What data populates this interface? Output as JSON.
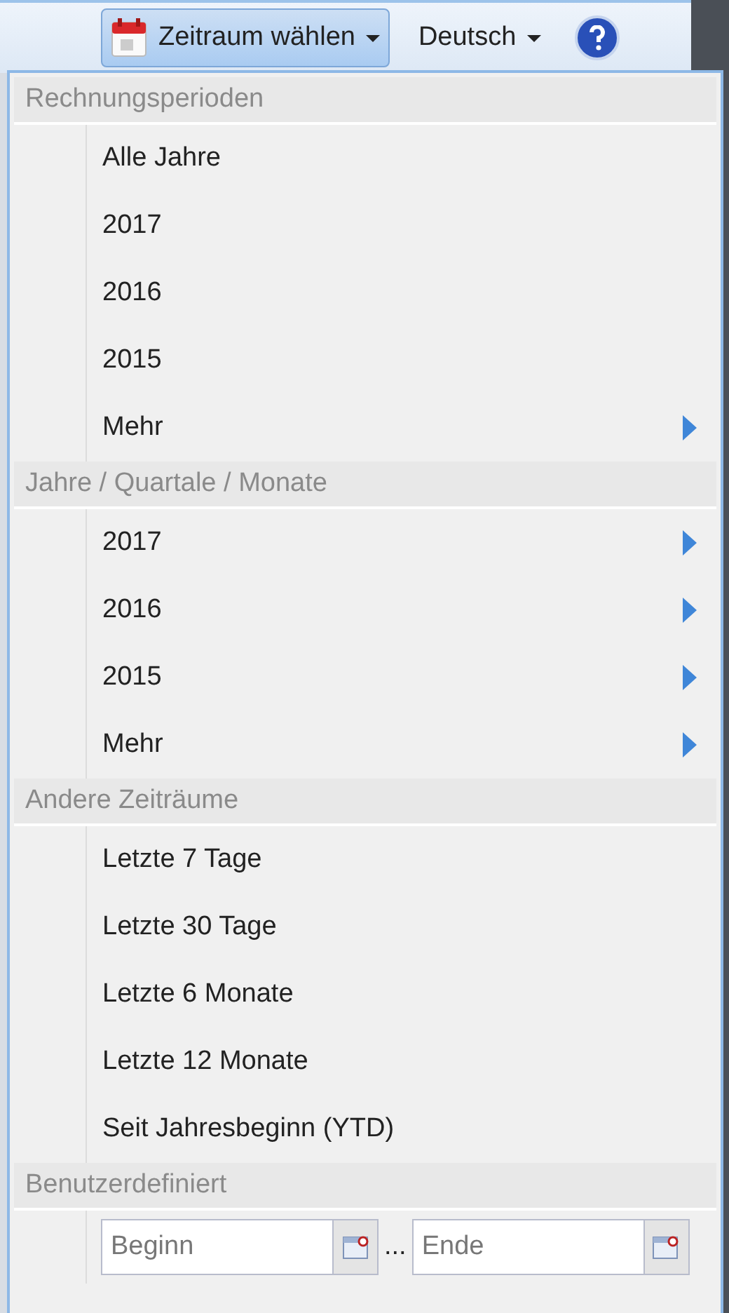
{
  "toolbar": {
    "period_button": "Zeitraum wählen",
    "language_button": "Deutsch"
  },
  "sections": [
    {
      "title": "Rechnungsperioden",
      "items": [
        {
          "label": "Alle Jahre",
          "has_submenu": false
        },
        {
          "label": "2017",
          "has_submenu": false
        },
        {
          "label": "2016",
          "has_submenu": false
        },
        {
          "label": "2015",
          "has_submenu": false
        },
        {
          "label": "Mehr",
          "has_submenu": true
        }
      ]
    },
    {
      "title": "Jahre / Quartale / Monate",
      "items": [
        {
          "label": "2017",
          "has_submenu": true
        },
        {
          "label": "2016",
          "has_submenu": true
        },
        {
          "label": "2015",
          "has_submenu": true
        },
        {
          "label": "Mehr",
          "has_submenu": true
        }
      ]
    },
    {
      "title": "Andere Zeiträume",
      "items": [
        {
          "label": "Letzte 7 Tage",
          "has_submenu": false
        },
        {
          "label": "Letzte 30 Tage",
          "has_submenu": false
        },
        {
          "label": "Letzte 6 Monate",
          "has_submenu": false
        },
        {
          "label": "Letzte 12 Monate",
          "has_submenu": false
        },
        {
          "label": "Seit Jahresbeginn (YTD)",
          "has_submenu": false
        }
      ]
    },
    {
      "title": "Benutzerdefiniert",
      "range": {
        "start_placeholder": "Beginn",
        "separator": "...",
        "end_placeholder": "Ende"
      }
    }
  ]
}
